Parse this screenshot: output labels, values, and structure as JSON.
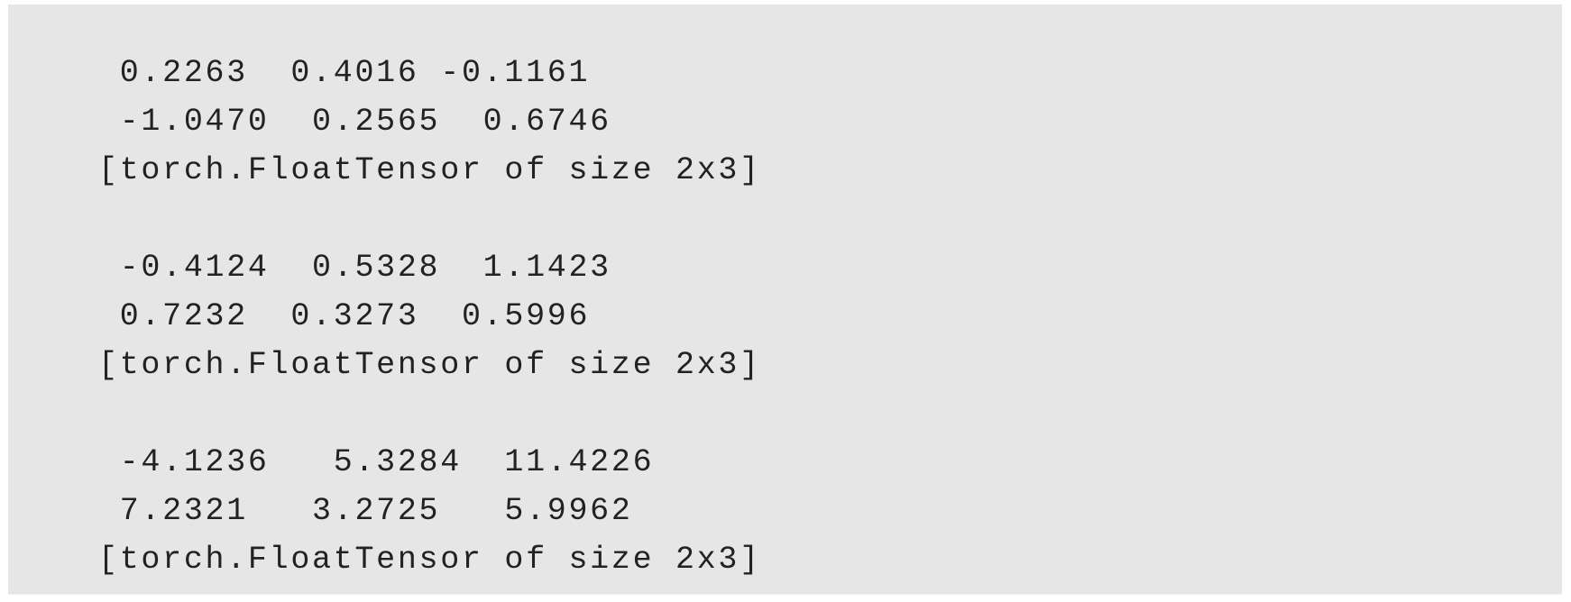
{
  "output": {
    "tensors": [
      {
        "rows": [
          " 0.2263  0.4016 -0.1161",
          " -1.0470  0.2565  0.6746"
        ],
        "footer": "[torch.FloatTensor of size 2x3]"
      },
      {
        "rows": [
          " -0.4124  0.5328  1.1423",
          " 0.7232  0.3273  0.5996"
        ],
        "footer": "[torch.FloatTensor of size 2x3]"
      },
      {
        "rows": [
          " -4.1236   5.3284  11.4226",
          " 7.2321   3.2725   5.9962"
        ],
        "footer": "[torch.FloatTensor of size 2x3]"
      }
    ]
  }
}
